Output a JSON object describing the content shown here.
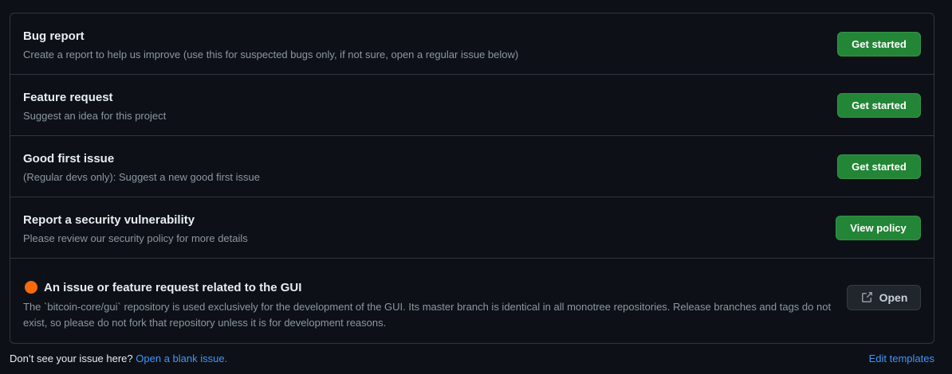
{
  "templates": [
    {
      "title": "Bug report",
      "description": "Create a report to help us improve (use this for suspected bugs only, if not sure, open a regular issue below)",
      "button_label": "Get started"
    },
    {
      "title": "Feature request",
      "description": "Suggest an idea for this project",
      "button_label": "Get started"
    },
    {
      "title": "Good first issue",
      "description": "(Regular devs only): Suggest a new good first issue",
      "button_label": "Get started"
    },
    {
      "title": "Report a security vulnerability",
      "description": "Please review our security policy for more details",
      "button_label": "View policy"
    },
    {
      "title": "An issue or feature request related to the GUI",
      "description": "The `bitcoin-core/gui` repository is used exclusively for the development of the GUI. Its master branch is identical in all monotree repositories. Release branches and tags do not exist, so please do not fork that repository unless it is for development reasons.",
      "button_label": "Open",
      "emoji_icon": "orange-circle-icon",
      "button_icon": "external-link-icon"
    }
  ],
  "footer": {
    "prompt": "Don’t see your issue here?",
    "blank_issue_link": "Open a blank issue.",
    "edit_templates_link": "Edit templates"
  },
  "colors": {
    "background": "#0d1117",
    "border": "#30363d",
    "primary_button": "#238636",
    "secondary_button": "#21262d",
    "link": "#4493f8",
    "muted_text": "#8d96a0",
    "orange_circle": "#f66a0a"
  }
}
